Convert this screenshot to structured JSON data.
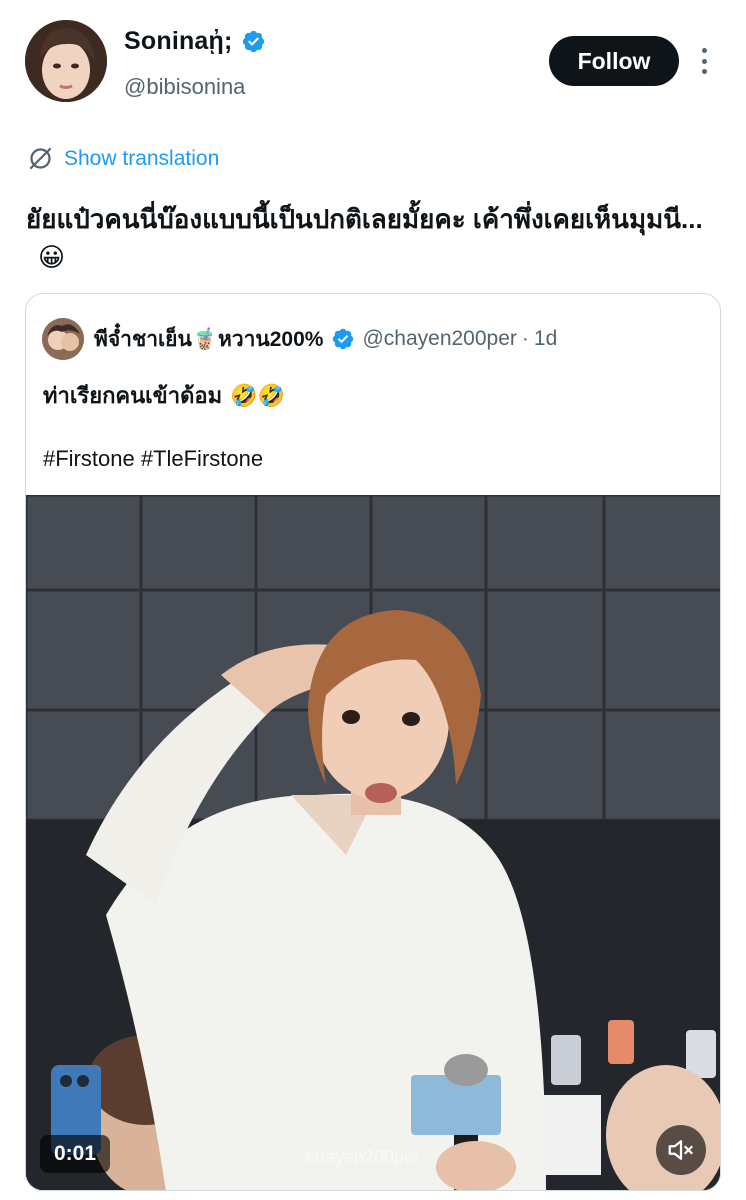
{
  "author": {
    "display_name": "Sonina",
    "name_suffix": "ᾐ;",
    "handle": "@bibisonina",
    "verified": true
  },
  "actions": {
    "follow_label": "Follow",
    "more_icon": "more-vertical-icon"
  },
  "translation": {
    "label": "Show translation",
    "icon": "globe-slash-icon"
  },
  "tweet": {
    "text": "ยัยแป๋วคนนี่บ๊องแบบนี้เป็นปกติเลยมั้ยคะ เค้าพึ่งเคยเห็นมุมนี...",
    "emoji": "😀"
  },
  "quoted": {
    "display_name": "พีจ๋ำชาเย็น🧋หวาน200%",
    "handle": "@chayen200per",
    "separator": "·",
    "time": "1d",
    "verified": true,
    "text": "ท่าเรียกคนเข้าด้อม",
    "emoji": "🤣🤣",
    "hashtags": "#Firstone #TleFirstone",
    "video": {
      "timestamp": "0:01",
      "watermark": "chayen200per",
      "mute_icon": "volume-muted-icon"
    }
  },
  "colors": {
    "accent": "#1d9bf0",
    "text_primary": "#0f1419",
    "text_secondary": "#536471",
    "border": "#cfd9de",
    "follow_bg": "#0f1419"
  }
}
